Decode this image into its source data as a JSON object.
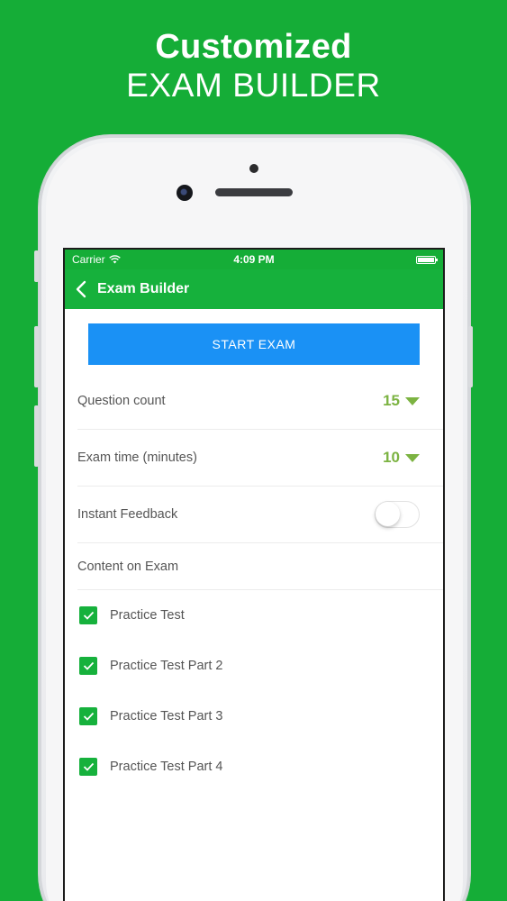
{
  "promo": {
    "line1": "Customized",
    "line2": "EXAM BUILDER"
  },
  "statusbar": {
    "carrier": "Carrier",
    "time": "4:09 PM"
  },
  "navbar": {
    "title": "Exam Builder"
  },
  "start_button": "START EXAM",
  "settings": {
    "question_count": {
      "label": "Question count",
      "value": "15"
    },
    "exam_time": {
      "label": "Exam time (minutes)",
      "value": "10"
    },
    "instant_feedback": {
      "label": "Instant Feedback",
      "enabled": false
    },
    "content_heading": "Content on Exam"
  },
  "content_items": [
    {
      "label": "Practice Test",
      "checked": true
    },
    {
      "label": "Practice Test Part 2",
      "checked": true
    },
    {
      "label": "Practice Test Part 3",
      "checked": true
    },
    {
      "label": "Practice Test Part 4",
      "checked": true
    }
  ],
  "colors": {
    "background": "#15ad37",
    "accent_blue": "#1a91f5",
    "dropdown_green": "#7cb342"
  }
}
